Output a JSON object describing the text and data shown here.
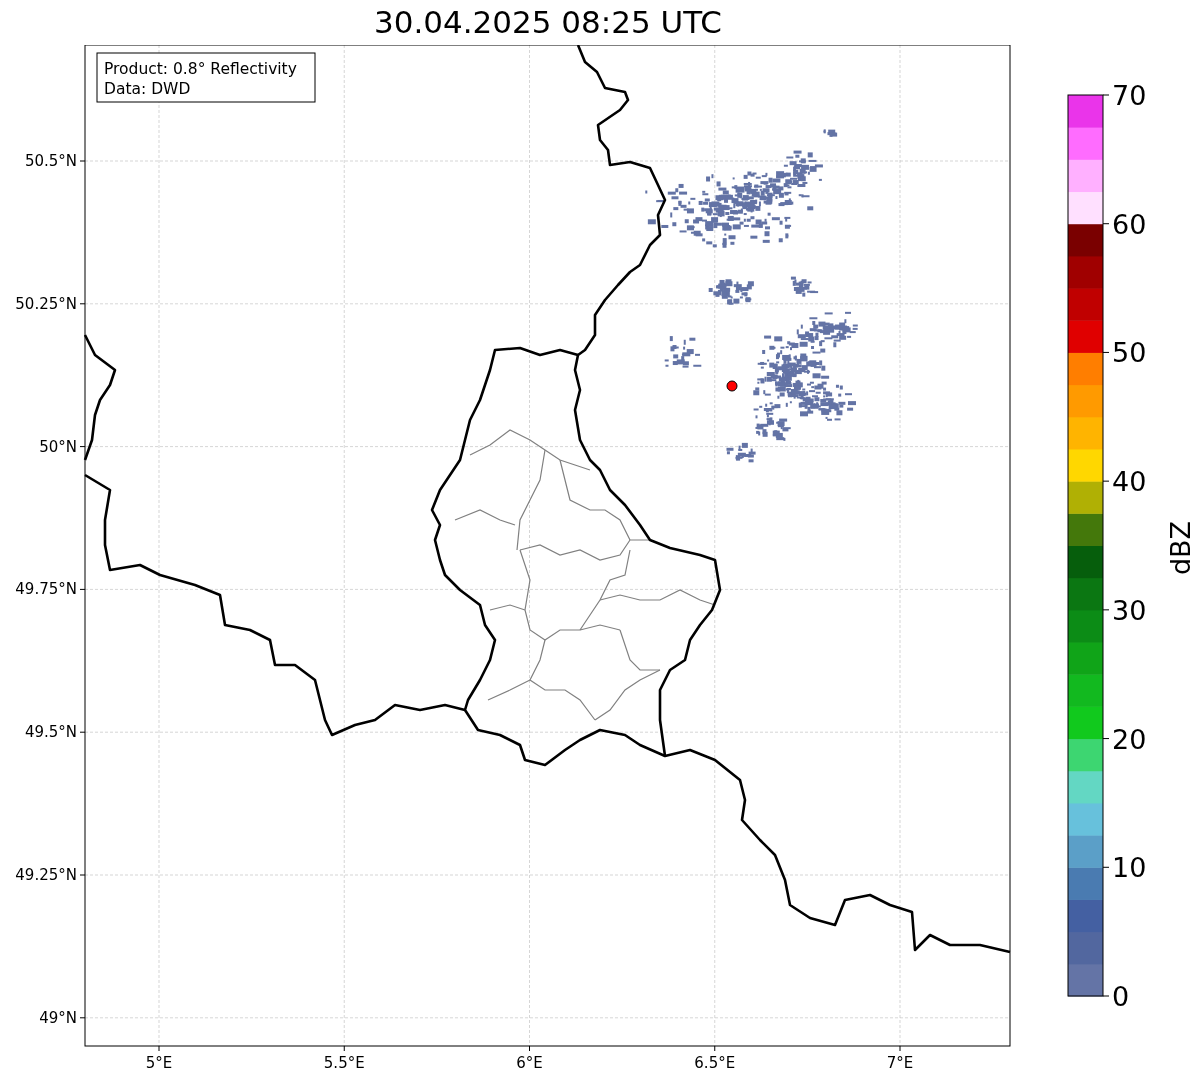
{
  "title": "30.04.2025 08:25 UTC",
  "annotation": [
    "Product: 0.8° Reflectivity",
    "Data: DWD"
  ],
  "map": {
    "xticks": [
      "5°E",
      "5.5°E",
      "6°E",
      "6.5°E",
      "7°E"
    ],
    "yticks": [
      "50.5°N",
      "50.25°N",
      "50°N",
      "49.75°N",
      "49.5°N",
      "49.25°N",
      "49°N"
    ]
  },
  "colorbar": {
    "label": "dBZ",
    "ticks": [
      "70",
      "60",
      "50",
      "40",
      "30",
      "20",
      "10",
      "0"
    ],
    "segments": [
      {
        "color": "#6474a6"
      },
      {
        "color": "#52679f"
      },
      {
        "color": "#4460a2"
      },
      {
        "color": "#4a7bb1"
      },
      {
        "color": "#5b9fc8"
      },
      {
        "color": "#67c1dc"
      },
      {
        "color": "#63d7c3"
      },
      {
        "color": "#3dd671"
      },
      {
        "color": "#11c91d"
      },
      {
        "color": "#12b91f"
      },
      {
        "color": "#10a418"
      },
      {
        "color": "#0c8c16"
      },
      {
        "color": "#0b7712"
      },
      {
        "color": "#065e0c"
      },
      {
        "color": "#44780b"
      },
      {
        "color": "#b0b004"
      },
      {
        "color": "#ffd700"
      },
      {
        "color": "#ffb400"
      },
      {
        "color": "#ff9a00"
      },
      {
        "color": "#ff7e00"
      },
      {
        "color": "#e00000"
      },
      {
        "color": "#c00000"
      },
      {
        "color": "#a00000"
      },
      {
        "color": "#7a0000"
      },
      {
        "color": "#ffe0ff"
      },
      {
        "color": "#ffb0ff"
      },
      {
        "color": "#ff6cff"
      },
      {
        "color": "#ea34ea"
      }
    ]
  }
}
